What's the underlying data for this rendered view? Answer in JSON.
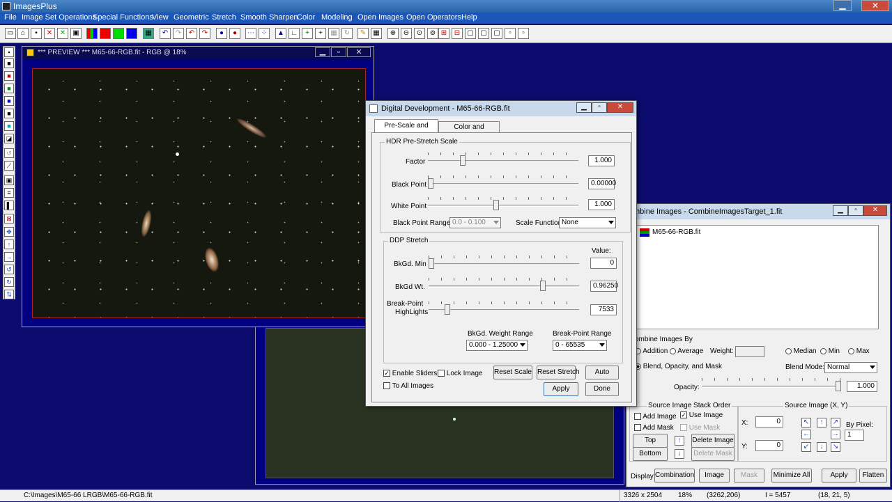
{
  "app": {
    "title": "ImagesPlus"
  },
  "menu": [
    "File",
    "Image Set Operations",
    "Special Functions",
    "View",
    "Geometric",
    "Stretch",
    "Smooth Sharpen",
    "Color",
    "Modeling",
    "Open Images",
    "Open Operators",
    "Help"
  ],
  "preview": {
    "title": "*** PREVIEW *** M65-66-RGB.fit - RGB @ 18%"
  },
  "dd": {
    "title": "Digital Development - M65-66-RGB.fit",
    "tabs": [
      "Pre-Scale and Stretch",
      "Color and Sharpness"
    ],
    "hdr_group": "HDR Pre-Stretch Scale",
    "factor_label": "Factor",
    "factor_value": "1.000",
    "factor_level": 0.22,
    "black_label": "Black Point",
    "black_value": "0.00000",
    "black_level": 0.0,
    "white_label": "White Point",
    "white_value": "1.000",
    "white_level": 0.45,
    "bpr_label": "Black Point Range",
    "bpr_value": "0.0 - 0.100",
    "sf_label": "Scale Function",
    "sf_value": "None",
    "ddp_group": "DDP Stretch",
    "value_header": "Value:",
    "bkmin_label": "BkGd. Min",
    "bkmin_value": "0",
    "bkmin_level": 0.0,
    "bkwt_label": "BkGd Wt.",
    "bkwt_value": "0.96250",
    "bkwt_level": 0.77,
    "bp_label_1": "Break-Point",
    "bp_label_2": "HighLights",
    "bp_value": "7533",
    "bp_level": 0.11,
    "bkwr_label": "BkGd. Weight Range",
    "bkwr_value": "0.000 - 1.25000",
    "bpr2_label": "Break-Point Range",
    "bpr2_value": "0 - 65535",
    "enable_sliders": "Enable Sliders",
    "lock_image": "Lock Image",
    "to_all": "To All Images",
    "reset_scale": "Reset Scale",
    "reset_stretch": "Reset Stretch",
    "auto": "Auto",
    "apply": "Apply",
    "done": "Done"
  },
  "ci": {
    "title": "mbine Images - CombineImagesTarget_1.fit",
    "list_item": "M65-66-RGB.fit",
    "by_label": "ombine Images By",
    "addition": "Addition",
    "average": "Average",
    "weight": "Weight:",
    "median": "Median",
    "min": "Min",
    "max": "Max",
    "blend": "Blend, Opacity, and Mask",
    "blend_mode_label": "Blend Mode:",
    "blend_mode": "Normal",
    "opacity_label": "Opacity:",
    "opacity_value": "1.000",
    "opacity_level": 1.0,
    "stack_group": "Source Image Stack Order",
    "add_image": "Add Image",
    "use_image": "Use Image",
    "add_mask": "Add Mask",
    "use_mask": "Use Mask",
    "top": "Top",
    "bottom": "Bottom",
    "delete_image": "Delete Image",
    "delete_mask": "Delete Mask",
    "xy_group": "Source Image (X, Y)",
    "x_label": "X:",
    "x_value": "0",
    "y_label": "Y:",
    "y_value": "0",
    "by_pixel": "By Pixel:",
    "by_pixel_value": "1",
    "display_label": "Display:",
    "combination": "Combination",
    "image": "Image",
    "mask": "Mask",
    "minimize_all": "Minimize All",
    "apply": "Apply",
    "flatten": "Flatten"
  },
  "status": {
    "path": "C:\\Images\\M65-66 LRGB\\M65-66-RGB.fit",
    "dims": "3326 x 2504",
    "zoom": "18%",
    "coords": "(3262,206)",
    "intensity": "I = 5457",
    "rgb": "(18, 21, 5)"
  }
}
